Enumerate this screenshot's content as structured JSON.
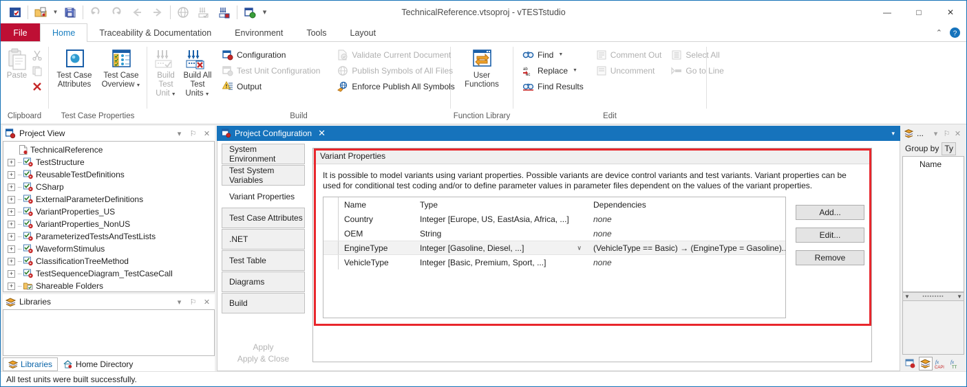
{
  "window": {
    "title": "TechnicalReference.vtsoproj - vTESTstudio",
    "minimize": "—",
    "maximize": "□",
    "close": "✕"
  },
  "quick_access": {
    "items": [
      {
        "name": "app-logo-icon",
        "label": ""
      },
      {
        "name": "open-project-icon",
        "label": ""
      },
      {
        "name": "save-all-icon",
        "label": ""
      },
      {
        "name": "undo-icon",
        "label": ""
      },
      {
        "name": "redo-icon",
        "label": ""
      },
      {
        "name": "back-icon",
        "label": ""
      },
      {
        "name": "forward-icon",
        "label": ""
      },
      {
        "name": "publish-symbols-icon",
        "label": ""
      },
      {
        "name": "build-test-unit-icon",
        "label": ""
      },
      {
        "name": "build-all-test-units-icon",
        "label": ""
      },
      {
        "name": "project-configuration-icon",
        "label": ""
      }
    ],
    "customize_caret": "─"
  },
  "ribbon": {
    "tabs": [
      {
        "label": "File",
        "active": false,
        "is_file": true
      },
      {
        "label": "Home",
        "active": true,
        "is_file": false
      },
      {
        "label": "Traceability & Documentation",
        "active": false,
        "is_file": false
      },
      {
        "label": "Environment",
        "active": false,
        "is_file": false
      },
      {
        "label": "Tools",
        "active": false,
        "is_file": false
      },
      {
        "label": "Layout",
        "active": false,
        "is_file": false
      }
    ],
    "collapse_caret": "⌃",
    "help_icon": "?",
    "groups": [
      {
        "title": "Clipboard",
        "paste_label": "Paste",
        "mini": [
          "cut-icon",
          "copy-icon",
          "clear-icon"
        ]
      },
      {
        "title": "Test Case Properties",
        "buttons": [
          {
            "label": "Test Case\nAttributes",
            "label_line1": "Test Case",
            "label_line2": "Attributes",
            "icon": "test-case-attributes-icon",
            "dropdown": false,
            "disabled": false
          },
          {
            "label": "Test Case\nOverview",
            "label_line1": "Test Case",
            "label_line2": "Overview",
            "icon": "test-case-overview-icon",
            "dropdown": true,
            "disabled": false
          }
        ]
      },
      {
        "title": "Build",
        "buttons": [
          {
            "label_line1": "Build Test",
            "label_line2": "Unit",
            "icon": "build-test-unit-icon",
            "dropdown": true,
            "disabled": true
          },
          {
            "label_line1": "Build All",
            "label_line2": "Test Units",
            "icon": "build-all-test-units-icon",
            "dropdown": true,
            "disabled": false
          }
        ],
        "col1": [
          {
            "label": "Configuration",
            "icon": "configuration-icon",
            "disabled": false
          },
          {
            "label": "Test Unit Configuration",
            "icon": "test-unit-configuration-icon",
            "disabled": true
          },
          {
            "label": "Output",
            "icon": "output-icon",
            "disabled": false
          }
        ],
        "col2": [
          {
            "label": "Validate Current Document",
            "icon": "validate-document-icon",
            "disabled": true
          },
          {
            "label": "Publish Symbols of All Files",
            "icon": "publish-symbols-icon",
            "disabled": true
          },
          {
            "label": "Enforce Publish All Symbols",
            "icon": "enforce-publish-icon",
            "disabled": false
          }
        ]
      },
      {
        "title": "Function Library",
        "buttons": [
          {
            "label_line1": "User",
            "label_line2": "Functions",
            "icon": "user-functions-icon",
            "dropdown": false,
            "disabled": false
          }
        ]
      },
      {
        "title": "Edit",
        "col1": [
          {
            "label": "Find",
            "icon": "find-icon",
            "disabled": false,
            "dropdown": true
          },
          {
            "label": "Replace",
            "icon": "replace-icon",
            "disabled": false,
            "dropdown": true
          },
          {
            "label": "Find Results",
            "icon": "find-results-icon",
            "disabled": false,
            "dropdown": false
          }
        ],
        "col2": [
          {
            "label": "Comment Out",
            "icon": "comment-out-icon",
            "disabled": true
          },
          {
            "label": "Uncomment",
            "icon": "uncomment-icon",
            "disabled": true
          }
        ],
        "col3": [
          {
            "label": "Select All",
            "icon": "select-all-icon",
            "disabled": true
          },
          {
            "label": "Go to Line",
            "icon": "go-to-line-icon",
            "disabled": true
          }
        ]
      }
    ]
  },
  "project_view": {
    "title": "Project View",
    "icon": "project-view-icon",
    "header_buttons": [
      "▾",
      "⚐",
      "✕"
    ],
    "root": {
      "label": "TechnicalReference",
      "icon": "project-file-icon"
    },
    "nodes": [
      {
        "label": "TestStructure",
        "icon": "test-unit-icon",
        "expander": "+"
      },
      {
        "label": "ReusableTestDefinitions",
        "icon": "test-unit-icon",
        "expander": "+"
      },
      {
        "label": "CSharp",
        "icon": "test-unit-icon",
        "expander": "+"
      },
      {
        "label": "ExternalParameterDefinitions",
        "icon": "test-unit-icon",
        "expander": "+"
      },
      {
        "label": "VariantProperties_US",
        "icon": "test-unit-icon",
        "expander": "+"
      },
      {
        "label": "VariantProperties_NonUS",
        "icon": "test-unit-icon",
        "expander": "+"
      },
      {
        "label": "ParameterizedTestsAndTestLists",
        "icon": "test-unit-icon",
        "expander": "+"
      },
      {
        "label": "WaveformStimulus",
        "icon": "test-unit-icon",
        "expander": "+"
      },
      {
        "label": "ClassificationTreeMethod",
        "icon": "test-unit-icon",
        "expander": "+"
      },
      {
        "label": "TestSequenceDiagram_TestCaseCall",
        "icon": "test-unit-icon",
        "expander": "+"
      },
      {
        "label": "Shareable Folders",
        "icon": "shareable-folders-icon",
        "expander": "+"
      }
    ]
  },
  "libraries_panel": {
    "title": "Libraries",
    "icon": "libraries-icon",
    "header_buttons": [
      "▾",
      "⚐",
      "✕"
    ],
    "tabs": [
      {
        "label": "Libraries",
        "icon": "libraries-icon",
        "active": true
      },
      {
        "label": "Home Directory",
        "icon": "home-directory-icon",
        "active": false
      }
    ]
  },
  "document": {
    "tab": {
      "label": "Project Configuration",
      "icon": "project-configuration-icon",
      "close": "✕"
    },
    "tabbar_dropdown": "▾"
  },
  "config_nav": {
    "items": [
      {
        "label": "System Environment",
        "active": false
      },
      {
        "label": "Test System Variables",
        "active": false
      },
      {
        "label": "Variant Properties",
        "active": true
      },
      {
        "label": "Test Case Attributes",
        "active": false
      },
      {
        "label": ".NET",
        "active": false
      },
      {
        "label": "Test Table",
        "active": false
      },
      {
        "label": "Diagrams",
        "active": false
      },
      {
        "label": "Build",
        "active": false
      }
    ],
    "apply": "Apply",
    "apply_close": "Apply & Close"
  },
  "variant_properties": {
    "section_title": "Variant Properties",
    "description": "It is possible to model variants using variant properties. Possible variants are device control variants and test variants. Variant properties can be used for conditional test coding and/or to define parameter values in parameter files dependent on the values of the variant properties.",
    "columns": [
      "Name",
      "Type",
      "Dependencies"
    ],
    "rows": [
      {
        "name": "Country",
        "type": "Integer [Europe, US, EastAsia, Africa, ...]",
        "dependencies": "none",
        "dependencies_none": true,
        "has_dropdown": false,
        "selected": false
      },
      {
        "name": "OEM",
        "type": "String",
        "dependencies": "none",
        "dependencies_none": true,
        "has_dropdown": false,
        "selected": false
      },
      {
        "name": "EngineType",
        "type": "Integer [Gasoline, Diesel, ...]",
        "dependencies": "(VehicleType == Basic) → (EngineType = Gasoline)...",
        "dependencies_none": false,
        "has_dropdown": true,
        "selected": true
      },
      {
        "name": "VehicleType",
        "type": "Integer [Basic, Premium, Sport, ...]",
        "dependencies": "none",
        "dependencies_none": true,
        "has_dropdown": false,
        "selected": false
      }
    ],
    "buttons": [
      {
        "label": "Add..."
      },
      {
        "label": "Edit..."
      },
      {
        "label": "Remove"
      }
    ],
    "highlight_color": "#e8262c"
  },
  "right_dock": {
    "title": "...",
    "icon": "symbol-explorer-icon",
    "header_buttons": [
      "▾",
      "⚐",
      "✕"
    ],
    "group_by_label": "Group by",
    "group_by_value": "Ty",
    "list_header": "Name",
    "scroll_left": "▼",
    "scroll_right": "▼",
    "tabs": [
      {
        "icon": "test-unit-explorer-icon",
        "selected": false
      },
      {
        "icon": "symbol-explorer-icon",
        "selected": true
      },
      {
        "icon": "capl-functions-icon",
        "selected": false
      },
      {
        "icon": "tt-functions-icon",
        "selected": false
      }
    ]
  },
  "status_bar": {
    "message": "All test units were built successfully."
  },
  "colors": {
    "accent_blue": "#1673bc",
    "file_tab_red": "#be0f34",
    "highlight_red": "#e8262c",
    "active_tab_text": "#1a7fc1",
    "panel_bg": "#f0f0f0"
  }
}
